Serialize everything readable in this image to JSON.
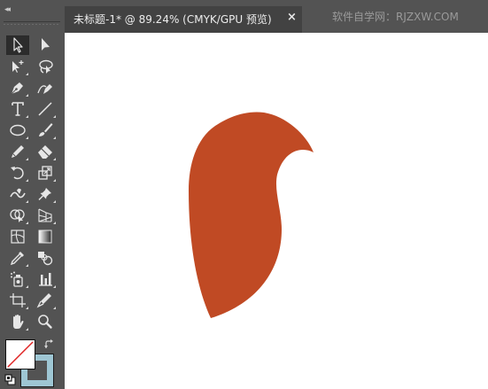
{
  "document_tab": {
    "title": "未标题-1* @ 89.24% (CMYK/GPU 预览)",
    "close_symbol": "×"
  },
  "watermark": "软件自学网：RJZXW.COM",
  "toolbar": {
    "collapse_symbol": "◂◂",
    "tools": [
      {
        "name": "selection-tool",
        "icon": "arrow-outline-icon",
        "active": true
      },
      {
        "name": "direct-selection-tool",
        "icon": "arrow-solid-icon"
      },
      {
        "name": "magic-wand-tool",
        "icon": "magic-wand-icon"
      },
      {
        "name": "lasso-tool",
        "icon": "lasso-icon"
      },
      {
        "name": "pen-tool",
        "icon": "pen-icon"
      },
      {
        "name": "curvature-tool",
        "icon": "curvature-pen-icon"
      },
      {
        "name": "type-tool",
        "icon": "type-icon",
        "glyph": "T"
      },
      {
        "name": "line-segment-tool",
        "icon": "line-icon"
      },
      {
        "name": "ellipse-tool",
        "icon": "ellipse-icon"
      },
      {
        "name": "paintbrush-tool",
        "icon": "brush-icon"
      },
      {
        "name": "pencil-tool",
        "icon": "pencil-icon"
      },
      {
        "name": "eraser-tool",
        "icon": "eraser-icon"
      },
      {
        "name": "rotate-tool",
        "icon": "rotate-icon"
      },
      {
        "name": "scale-tool",
        "icon": "scale-icon"
      },
      {
        "name": "warp-tool",
        "icon": "warp-icon"
      },
      {
        "name": "puppet-warp-tool",
        "icon": "pushpin-icon"
      },
      {
        "name": "shape-builder-tool",
        "icon": "shape-builder-icon"
      },
      {
        "name": "perspective-grid-tool",
        "icon": "perspective-grid-icon"
      },
      {
        "name": "mesh-tool",
        "icon": "mesh-icon"
      },
      {
        "name": "gradient-tool",
        "icon": "gradient-icon"
      },
      {
        "name": "eyedropper-tool",
        "icon": "eyedropper-icon"
      },
      {
        "name": "blend-tool",
        "icon": "blend-icon"
      },
      {
        "name": "symbol-sprayer-tool",
        "icon": "symbol-sprayer-icon"
      },
      {
        "name": "column-graph-tool",
        "icon": "bar-graph-icon"
      },
      {
        "name": "artboard-tool",
        "icon": "artboard-icon"
      },
      {
        "name": "slice-tool",
        "icon": "slice-knife-icon"
      },
      {
        "name": "hand-tool",
        "icon": "hand-icon"
      },
      {
        "name": "zoom-tool",
        "icon": "magnifier-icon"
      }
    ],
    "fill": {
      "color": "#ffffff",
      "state": "none"
    },
    "stroke": {
      "color": "#9ec6d3"
    }
  },
  "canvas": {
    "background": "#ffffff",
    "shape_color": "#c04a24"
  }
}
